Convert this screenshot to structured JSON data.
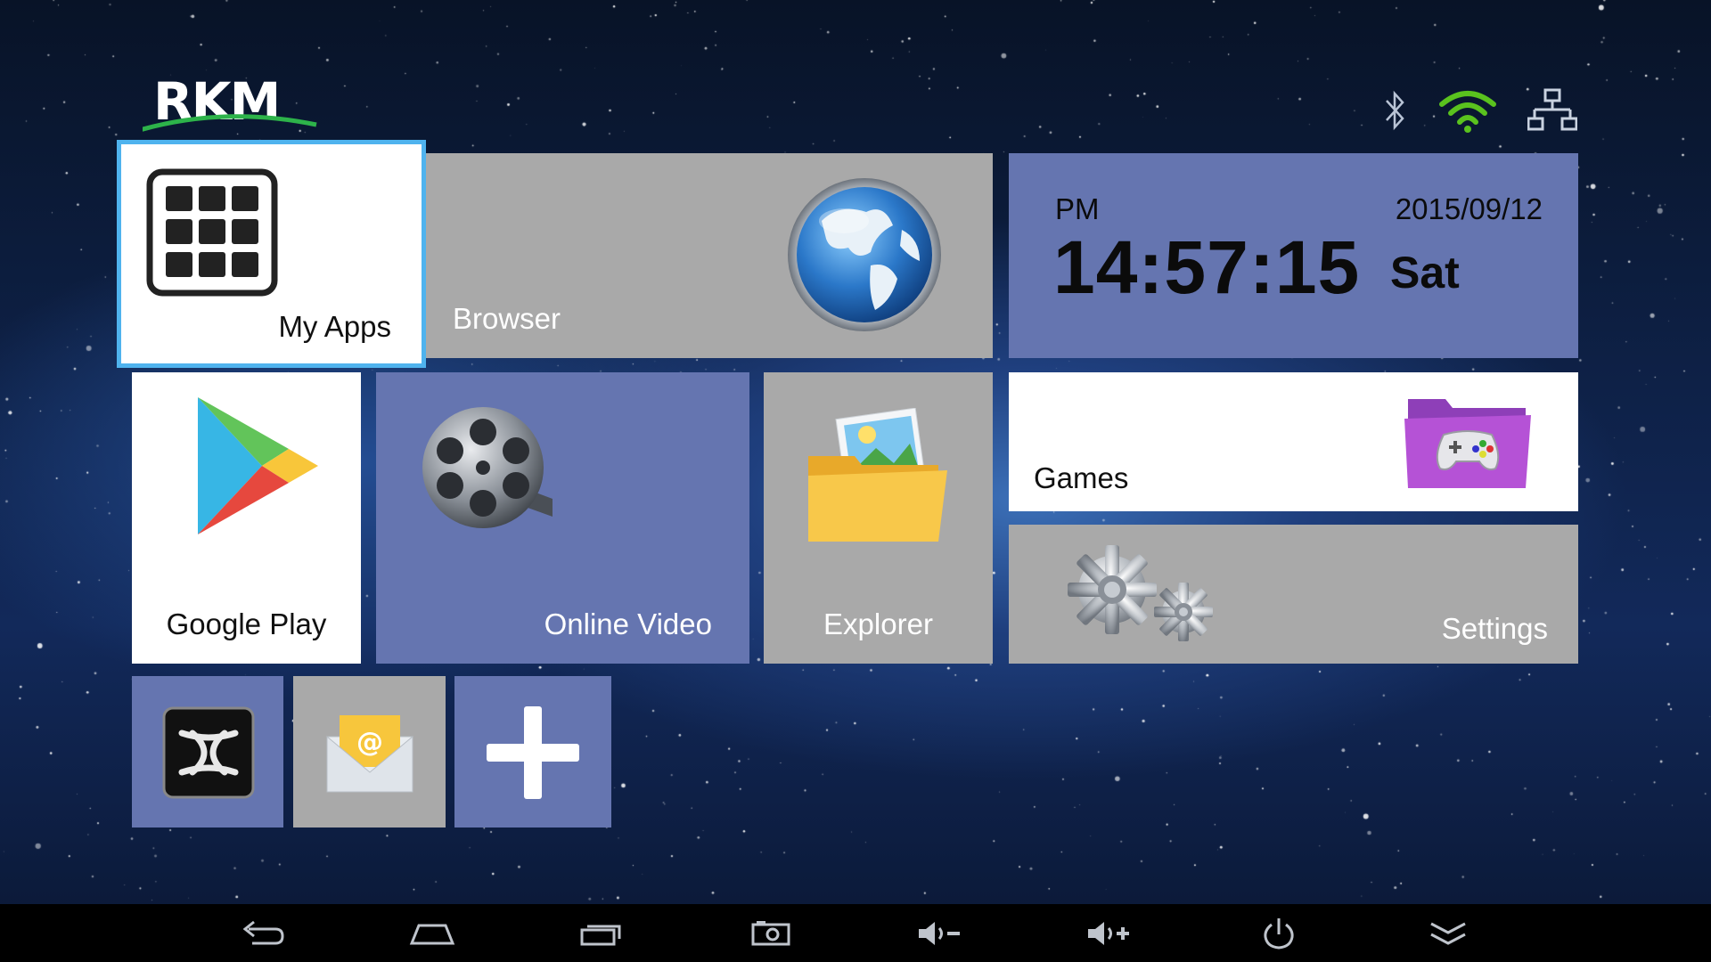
{
  "logo": {
    "text": "RKM"
  },
  "status": {
    "icons": [
      "bluetooth-icon",
      "wifi-icon",
      "ethernet-icon"
    ],
    "wifi_color": "#5ac21e"
  },
  "tiles": {
    "my_apps": {
      "label": "My Apps",
      "icon": "grid-icon"
    },
    "browser": {
      "label": "Browser",
      "icon": "globe-icon"
    },
    "google_play": {
      "label": "Google Play",
      "icon": "play-store-icon"
    },
    "online_video": {
      "label": "Online Video",
      "icon": "film-reel-icon"
    },
    "explorer": {
      "label": "Explorer",
      "icon": "folder-images-icon"
    },
    "games": {
      "label": "Games",
      "icon": "games-folder-icon"
    },
    "settings": {
      "label": "Settings",
      "icon": "gears-icon"
    },
    "shortcuts": [
      {
        "icon": "kodi-icon"
      },
      {
        "icon": "email-icon"
      },
      {
        "icon": "add-icon"
      }
    ]
  },
  "clock": {
    "ampm": "PM",
    "time": "14:57:15",
    "date": "2015/09/12",
    "day": "Sat"
  },
  "colors": {
    "tile_blue": "#6575b0",
    "tile_gray": "#a9a9a9",
    "focus_border": "#4fb3ee"
  },
  "navbar": {
    "buttons": [
      "back-icon",
      "home-icon",
      "recent-apps-icon",
      "screenshot-icon",
      "volume-down-icon",
      "volume-up-icon",
      "power-icon",
      "hide-bar-icon"
    ]
  }
}
